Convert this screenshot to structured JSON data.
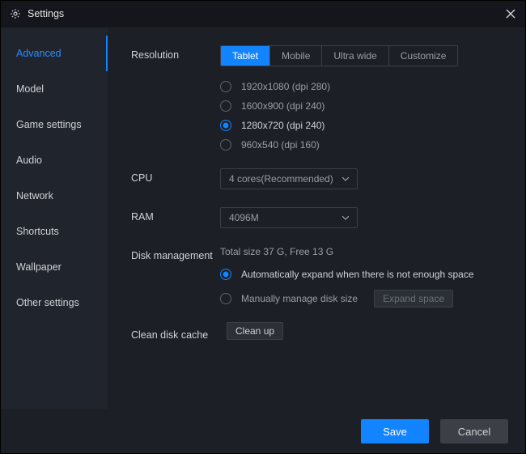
{
  "header": {
    "title": "Settings"
  },
  "sidebar": {
    "items": [
      {
        "label": "Advanced",
        "active": true
      },
      {
        "label": "Model"
      },
      {
        "label": "Game settings"
      },
      {
        "label": "Audio"
      },
      {
        "label": "Network"
      },
      {
        "label": "Shortcuts"
      },
      {
        "label": "Wallpaper"
      },
      {
        "label": "Other settings"
      }
    ]
  },
  "main": {
    "resolution": {
      "label": "Resolution",
      "tabs": [
        {
          "label": "Tablet",
          "active": true
        },
        {
          "label": "Mobile"
        },
        {
          "label": "Ultra wide"
        },
        {
          "label": "Customize"
        }
      ],
      "options": [
        {
          "label": "1920x1080  (dpi 280)",
          "checked": false
        },
        {
          "label": "1600x900  (dpi 240)",
          "checked": false
        },
        {
          "label": "1280x720  (dpi 240)",
          "checked": true
        },
        {
          "label": "960x540  (dpi 160)",
          "checked": false
        }
      ]
    },
    "cpu": {
      "label": "CPU",
      "value": "4 cores(Recommended)"
    },
    "ram": {
      "label": "RAM",
      "value": "4096M"
    },
    "disk": {
      "label": "Disk management",
      "info": "Total size 37 G,   Free 13 G",
      "opt_auto": "Automatically expand when there is not enough space",
      "opt_manual": "Manually manage disk size",
      "expand_btn": "Expand space",
      "selected": "auto"
    },
    "clean": {
      "label": "Clean disk cache",
      "btn": "Clean up"
    }
  },
  "footer": {
    "save": "Save",
    "cancel": "Cancel"
  }
}
